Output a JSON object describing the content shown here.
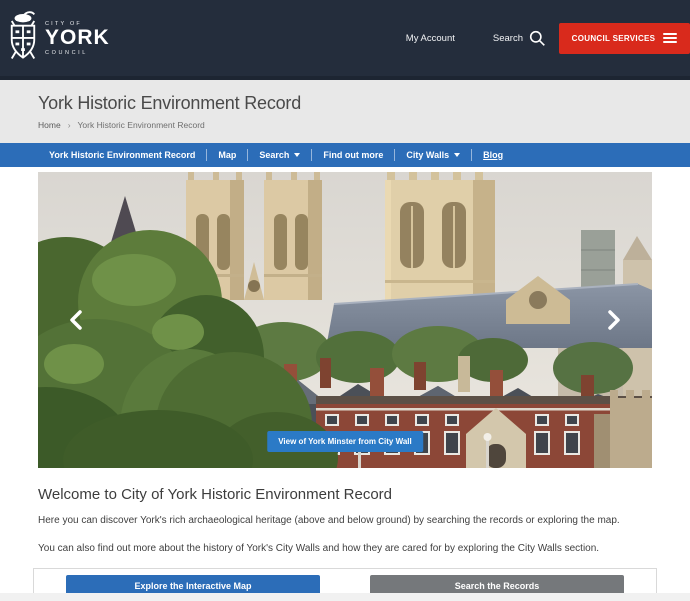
{
  "header": {
    "logo": {
      "line1": "CITY OF",
      "line2": "YORK",
      "line3": "COUNCIL"
    },
    "my_account": "My Account",
    "search": "Search",
    "council_services": "COUNCIL SERVICES"
  },
  "page": {
    "title": "York Historic Environment Record",
    "breadcrumb": {
      "home": "Home",
      "separator": "›",
      "current": "York Historic Environment Record"
    }
  },
  "nav": {
    "items": [
      {
        "label": "York Historic Environment Record",
        "dropdown": false
      },
      {
        "label": "Map",
        "dropdown": false
      },
      {
        "label": "Search",
        "dropdown": true
      },
      {
        "label": "Find out more",
        "dropdown": false
      },
      {
        "label": "City Walls",
        "dropdown": true
      },
      {
        "label": "Blog",
        "dropdown": false
      }
    ]
  },
  "carousel": {
    "caption": "View of York Minster from City Wall"
  },
  "main": {
    "heading": "Welcome to City of York Historic Environment Record",
    "p1": "Here you can discover York's rich archaeological heritage (above and below ground) by searching the records or exploring the map.",
    "p2": "You can also find out more about the history of York's City Walls and how they are cared for by exploring the City Walls section.",
    "buttons": [
      {
        "label": "Explore the Interactive Map"
      },
      {
        "label": "Search the Records"
      }
    ]
  },
  "icons": {
    "search": "magnifier",
    "menu": "hamburger",
    "prev": "chevron-left",
    "next": "chevron-right",
    "dropdown": "caret-down",
    "crest": "york-coat-of-arms"
  },
  "colors": {
    "header_bg": "#242d3c",
    "accent_red": "#d92a1c",
    "nav_blue": "#2c6db8",
    "caption_blue": "#2b7ac6",
    "band_gray": "#e8e8e8",
    "button_gray": "#75787b"
  }
}
